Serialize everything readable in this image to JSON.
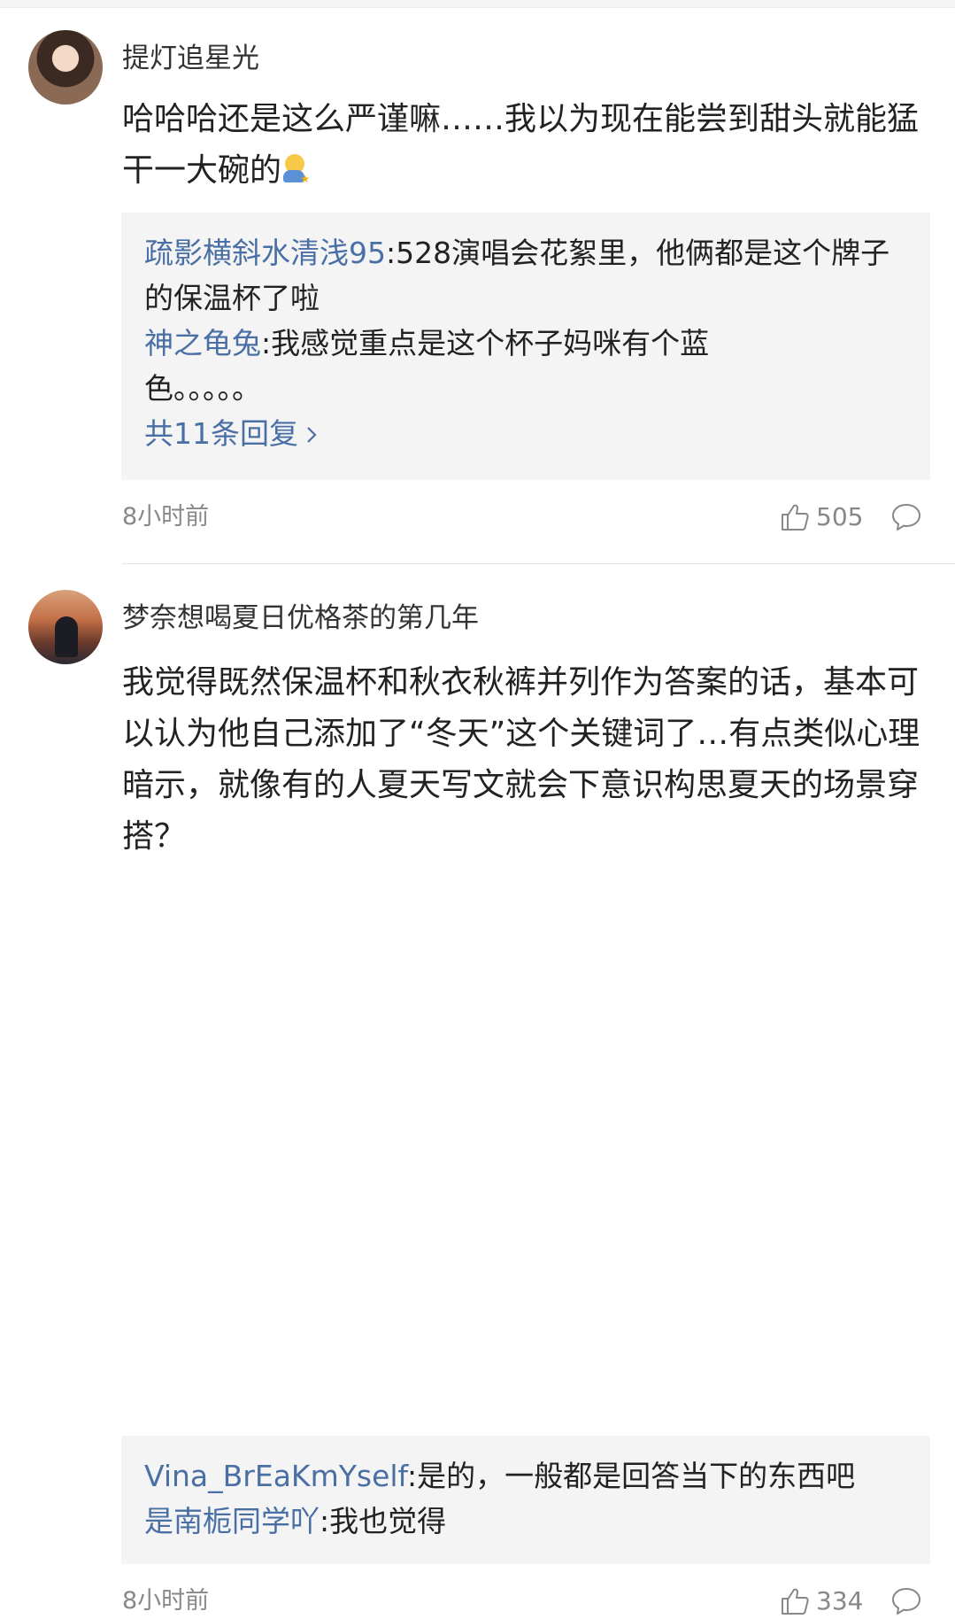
{
  "comments": [
    {
      "username": "提灯追星光",
      "content_text": "哈哈哈还是这么严谨嘛……我以为现在能尝到甜头就能猛干一大碗的",
      "content_emoji": "hugging-face-emoji",
      "replies": [
        {
          "user": "疏影横斜水清浅95",
          "sep": ":",
          "text": "528演唱会花絮里，他俩都是这个牌子的保温杯了啦"
        },
        {
          "user": "神之龟兔",
          "sep": ":",
          "text": "我感觉重点是这个杯子妈咪有个蓝色。。。。。"
        }
      ],
      "more_replies": "共11条回复",
      "more_icon": "chevron-right-icon",
      "time": "8小时前",
      "likes": "505"
    },
    {
      "username": "梦奈想喝夏日优格茶的第几年",
      "content_text": "我觉得既然保温杯和秋衣秋裤并列作为答案的话，基本可以认为他自己添加了“冬天”这个关键词了…有点类似心理暗示，就像有的人夏天写文就会下意识构思夏天的场景穿搭？",
      "replies": [
        {
          "user": "Vina_BrEaKmYself",
          "sep": ":",
          "text": "是的，一般都是回答当下的东西吧"
        },
        {
          "user": "是南栀同学吖",
          "sep": ":",
          "text": "我也觉得"
        }
      ],
      "time": "8小时前",
      "likes": "334"
    }
  ],
  "icons": {
    "like": "thumbs-up-icon",
    "comment": "comment-bubble-icon"
  },
  "colors": {
    "link": "#4a6fa5",
    "reply_bg": "#f4f4f4",
    "meta": "#888888"
  }
}
